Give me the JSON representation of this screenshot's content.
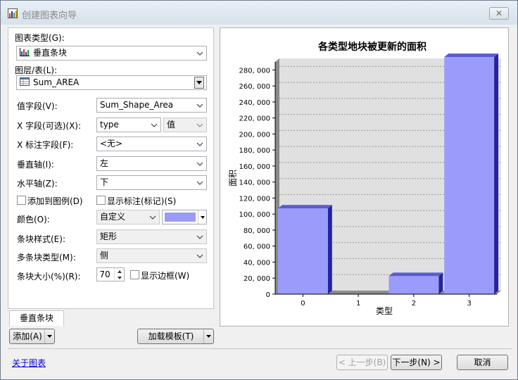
{
  "window": {
    "title": "创建图表向导",
    "close_label": "✕"
  },
  "left": {
    "chart_type_label": "图表类型(G):",
    "chart_type_value": "垂直条块",
    "layer_label": "图层/表(L):",
    "layer_value": "Sum_AREA",
    "value_field_label": "值字段(V):",
    "value_field_value": "Sum_Shape_Area",
    "x_field_label": "X 字段(可选)(X):",
    "x_field_value": "type",
    "x_sort_value": "值",
    "x_label_field_label": "X 标注字段(F):",
    "x_label_field_value": "<无>",
    "vertical_axis_label": "垂直轴(I):",
    "vertical_axis_value": "左",
    "horizontal_axis_label": "水平轴(Z):",
    "horizontal_axis_value": "下",
    "add_to_legend_label": "添加到图例(D)",
    "show_labels_label": "显示标注(标记)(S)",
    "color_label": "颜色(O):",
    "color_value": "自定义",
    "bar_style_label": "条块样式(E):",
    "bar_style_value": "矩形",
    "multi_bar_type_label": "多条块类型(M):",
    "multi_bar_type_value": "侧",
    "bar_size_label": "条块大小(%)(R):",
    "bar_size_value": "70",
    "show_border_label": "显示边框(W)"
  },
  "tab_label": "垂直条块",
  "buttons": {
    "add": "添加(A)",
    "load_template": "加载模板(T)",
    "back": "< 上一步(B)",
    "next": "下一步(N) >",
    "cancel": "取消"
  },
  "about_link": "关于图表",
  "colors": {
    "bar_front": "#9b9bfb",
    "bar_side": "#24249e",
    "bar_top": "#5b5bd6",
    "wall": "#e0e0e0",
    "color_swatch": "#9b9bf5"
  },
  "chart_data": {
    "type": "bar",
    "title": "各类型地块被更新的面积",
    "xlabel": "类型",
    "ylabel": "面积",
    "categories": [
      "0",
      "1",
      "2",
      "3"
    ],
    "values": [
      107000,
      0,
      22500,
      296000
    ],
    "ylim": [
      0,
      290000
    ],
    "yticks": [
      0,
      20000,
      40000,
      60000,
      80000,
      100000,
      120000,
      140000,
      160000,
      180000,
      200000,
      220000,
      240000,
      260000,
      280000
    ],
    "ytick_labels": [
      "0",
      "20, 000",
      "40, 000",
      "60, 000",
      "80, 000",
      "100, 000",
      "120, 000",
      "140, 000",
      "160, 000",
      "180, 000",
      "200, 000",
      "220, 000",
      "240, 000",
      "260, 000",
      "280, 000"
    ],
    "grid": true,
    "legend": false
  }
}
